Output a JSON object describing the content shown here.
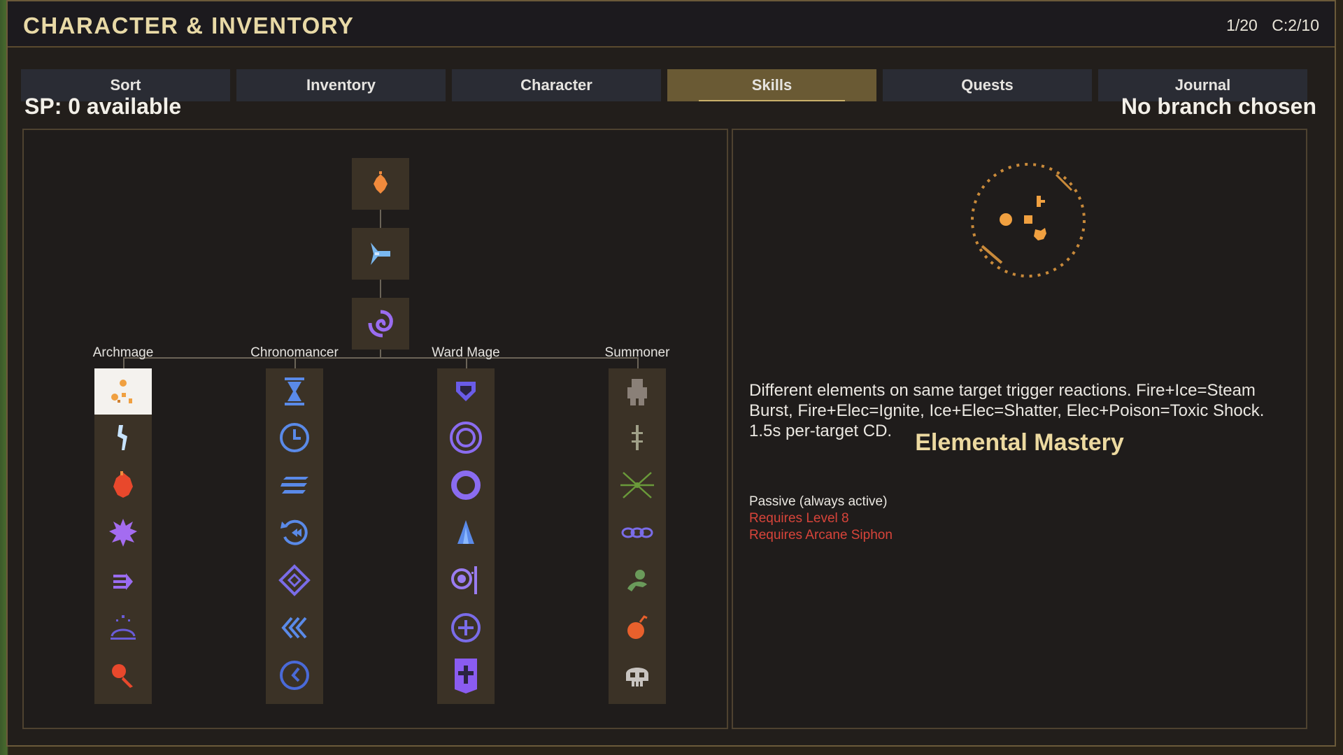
{
  "window": {
    "title": "CHARACTER & INVENTORY",
    "counter_a": "1/20",
    "counter_b": "C:2/10"
  },
  "tabs": [
    {
      "label": "Sort",
      "active": false
    },
    {
      "label": "Inventory",
      "active": false
    },
    {
      "label": "Character",
      "active": false
    },
    {
      "label": "Skills",
      "active": true
    },
    {
      "label": "Quests",
      "active": false
    },
    {
      "label": "Journal",
      "active": false
    }
  ],
  "skills": {
    "sp_text": "SP: 0 available",
    "branch_text": "No branch chosen",
    "trunk": [
      {
        "icon": "fire-orb-icon",
        "color": "#f08a3c"
      },
      {
        "icon": "ice-shard-icon",
        "color": "#7ab8f0"
      },
      {
        "icon": "arcane-swirl-icon",
        "color": "#9a6cf0"
      }
    ],
    "branches": [
      {
        "name": "Archmage",
        "nodes": [
          {
            "icon": "elemental-mastery-icon",
            "color": "#f0a040",
            "selected": true
          },
          {
            "icon": "lightning-bolt-icon",
            "color": "#c8e4ff"
          },
          {
            "icon": "fireball-icon",
            "color": "#e8482c"
          },
          {
            "icon": "arcane-burst-icon",
            "color": "#a46cf0"
          },
          {
            "icon": "arcane-missile-icon",
            "color": "#9a6cf0"
          },
          {
            "icon": "meteor-shower-icon",
            "color": "#6a5cd8"
          },
          {
            "icon": "flame-wand-icon",
            "color": "#e8482c"
          }
        ]
      },
      {
        "name": "Chronomancer",
        "nodes": [
          {
            "icon": "hourglass-icon",
            "color": "#5a8ae8"
          },
          {
            "icon": "clock-icon",
            "color": "#5a8ae8"
          },
          {
            "icon": "haste-lines-icon",
            "color": "#5a8ae8"
          },
          {
            "icon": "rewind-icon",
            "color": "#5a8ae8"
          },
          {
            "icon": "time-diamond-icon",
            "color": "#7a6ce8"
          },
          {
            "icon": "quicken-chevrons-icon",
            "color": "#5a8ae8"
          },
          {
            "icon": "time-stop-icon",
            "color": "#4a6ad8"
          }
        ]
      },
      {
        "name": "Ward Mage",
        "nodes": [
          {
            "icon": "shield-icon",
            "color": "#6a5ce8"
          },
          {
            "icon": "double-ring-icon",
            "color": "#8a6cf0"
          },
          {
            "icon": "ring-icon",
            "color": "#8a6cf0"
          },
          {
            "icon": "crystal-spire-icon",
            "color": "#5a8ae8"
          },
          {
            "icon": "bastion-icon",
            "color": "#9a7cf0"
          },
          {
            "icon": "plus-circle-icon",
            "color": "#7a6ce8"
          },
          {
            "icon": "sanctuary-banner-icon",
            "color": "#8a5cf0"
          }
        ]
      },
      {
        "name": "Summoner",
        "nodes": [
          {
            "icon": "golem-icon",
            "color": "#8a8078"
          },
          {
            "icon": "totem-icon",
            "color": "#a0a088"
          },
          {
            "icon": "spirit-burst-icon",
            "color": "#6a9a3a"
          },
          {
            "icon": "chain-icon",
            "color": "#7a6ce8"
          },
          {
            "icon": "familiar-icon",
            "color": "#6a9a5a"
          },
          {
            "icon": "bomb-imp-icon",
            "color": "#e8602c"
          },
          {
            "icon": "skull-icon",
            "color": "#c8c4c0"
          }
        ]
      }
    ]
  },
  "detail": {
    "icon": "elemental-mastery-icon",
    "name": "Elemental Mastery",
    "description": "Different elements on same target trigger reactions. Fire+Ice=Steam Burst, Fire+Elec=Ignite, Ice+Elec=Shatter, Elec+Poison=Toxic Shock. 1.5s per-target CD.",
    "type": "Passive (always active)",
    "requirements": [
      "Requires Level 8",
      "Requires Arcane Siphon"
    ]
  }
}
